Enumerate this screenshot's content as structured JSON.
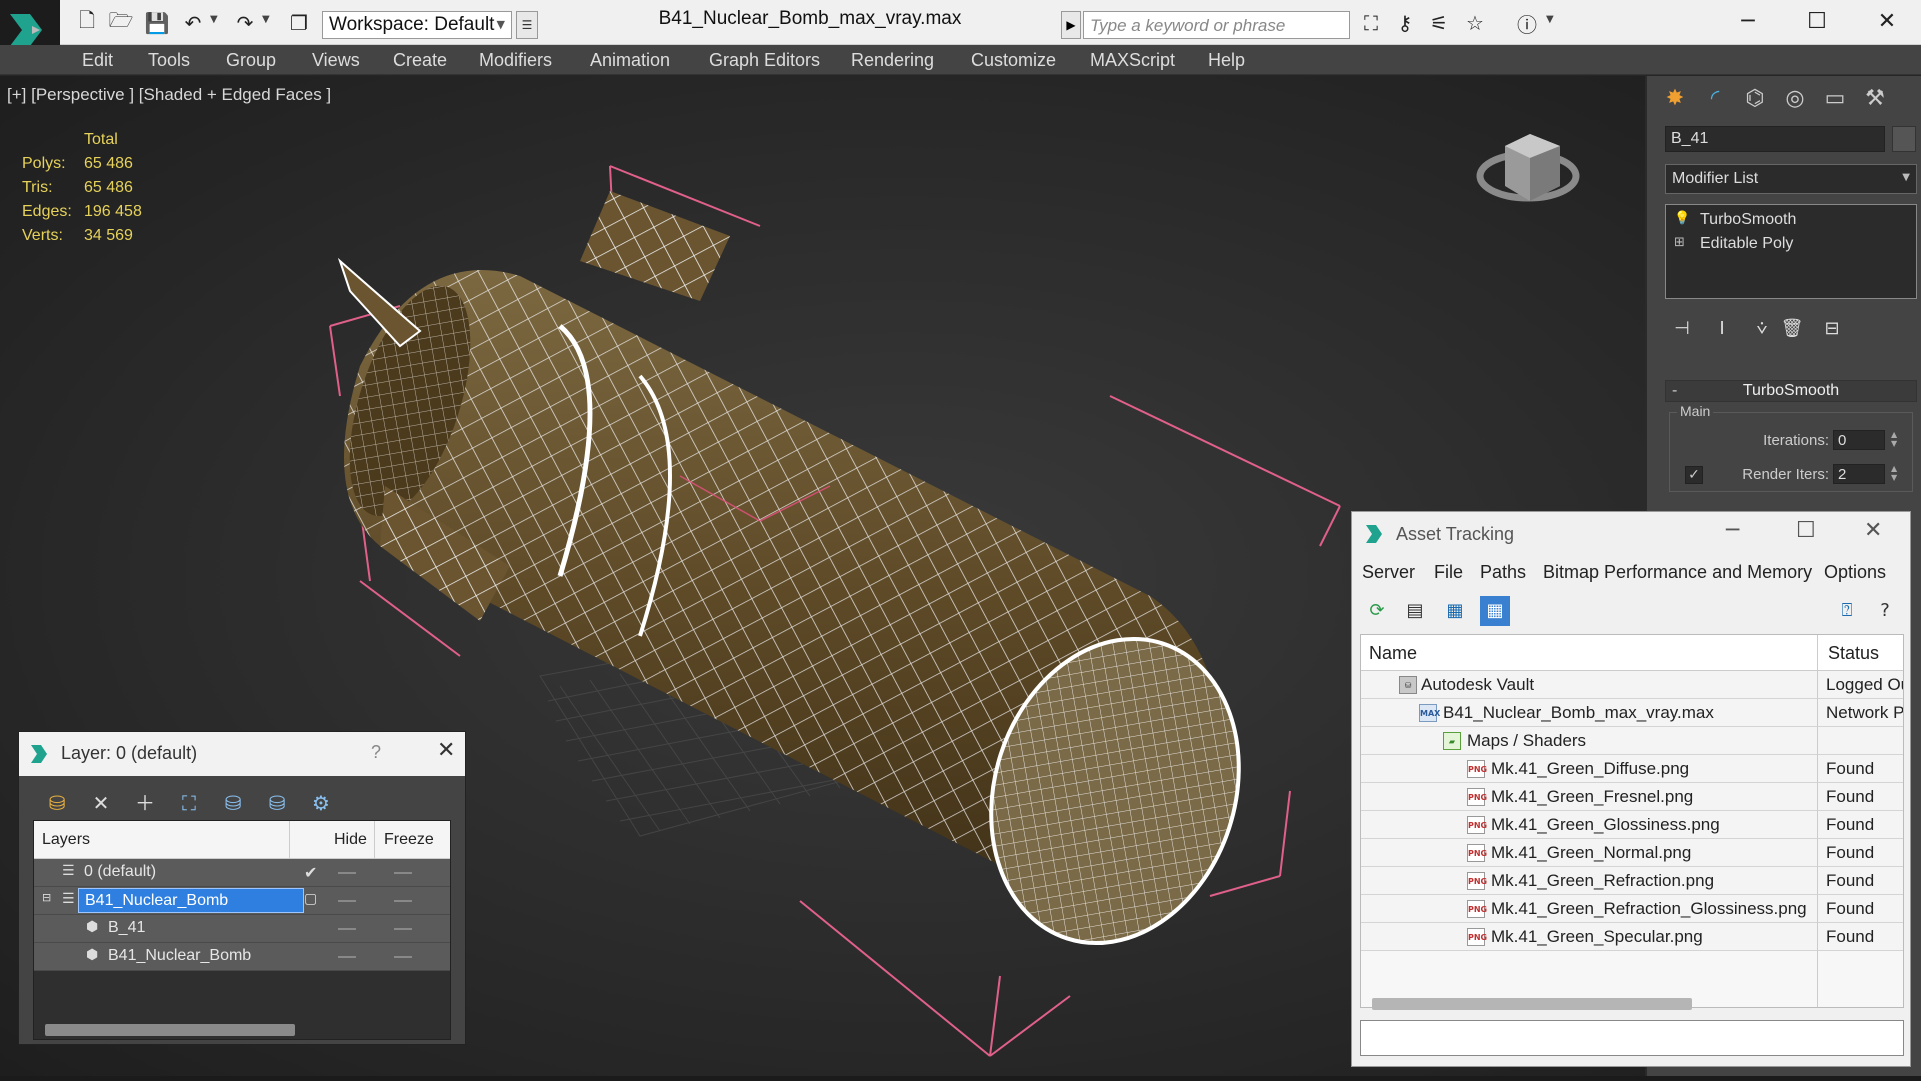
{
  "window": {
    "title": "B41_Nuclear_Bomb_max_vray.max",
    "workspace": "Workspace: Default",
    "search_placeholder": "Type a keyword or phrase"
  },
  "menu": [
    "Edit",
    "Tools",
    "Group",
    "Views",
    "Create",
    "Modifiers",
    "Animation",
    "Graph Editors",
    "Rendering",
    "Customize",
    "MAXScript",
    "Help"
  ],
  "viewport": {
    "label": "[+] [Perspective ] [Shaded + Edged Faces ]",
    "stats": {
      "header": "Total",
      "rows": [
        {
          "label": "Polys:",
          "value": "65 486"
        },
        {
          "label": "Tris:",
          "value": "65 486"
        },
        {
          "label": "Edges:",
          "value": "196 458"
        },
        {
          "label": "Verts:",
          "value": "34 569"
        }
      ]
    }
  },
  "command_panel": {
    "object_name": "B_41",
    "modifier_list": "Modifier List",
    "stack": [
      {
        "label": "TurboSmooth",
        "icon": "lightbulb-icon"
      },
      {
        "label": "Editable Poly",
        "icon": "plus-icon"
      }
    ],
    "rollout": {
      "title": "TurboSmooth",
      "group": "Main",
      "iterations_label": "Iterations:",
      "iterations_value": "0",
      "render_iters_label": "Render Iters:",
      "render_iters_value": "2",
      "render_iters_checked": true
    }
  },
  "layer_dialog": {
    "title": "Layer: 0 (default)",
    "help": "?",
    "columns": {
      "layers": "Layers",
      "hide": "Hide",
      "freeze": "Freeze"
    },
    "rows": [
      {
        "name": "0 (default)",
        "indent": 0,
        "icon": "layer-icon",
        "current": true,
        "selected": false
      },
      {
        "name": "B41_Nuclear_Bomb",
        "indent": 0,
        "icon": "layer-icon",
        "current": false,
        "selected": true
      },
      {
        "name": "B_41",
        "indent": 1,
        "icon": "object-icon",
        "current": false,
        "selected": false
      },
      {
        "name": "B41_Nuclear_Bomb",
        "indent": 1,
        "icon": "object-icon",
        "current": false,
        "selected": false
      }
    ]
  },
  "asset_tracking": {
    "title": "Asset Tracking",
    "menu": [
      "Server",
      "File",
      "Paths",
      "Bitmap Performance and Memory",
      "Options"
    ],
    "columns": {
      "name": "Name",
      "status": "Status"
    },
    "rows": [
      {
        "name": "Autodesk Vault",
        "status": "Logged Out",
        "level": 0,
        "icon": "vault"
      },
      {
        "name": "B41_Nuclear_Bomb_max_vray.max",
        "status": "Network Path",
        "level": 1,
        "icon": "max"
      },
      {
        "name": "Maps / Shaders",
        "status": "",
        "level": 2,
        "icon": "folder"
      },
      {
        "name": "Mk.41_Green_Diffuse.png",
        "status": "Found",
        "level": 3,
        "icon": "png"
      },
      {
        "name": "Mk.41_Green_Fresnel.png",
        "status": "Found",
        "level": 3,
        "icon": "png"
      },
      {
        "name": "Mk.41_Green_Glossiness.png",
        "status": "Found",
        "level": 3,
        "icon": "png"
      },
      {
        "name": "Mk.41_Green_Normal.png",
        "status": "Found",
        "level": 3,
        "icon": "png"
      },
      {
        "name": "Mk.41_Green_Refraction.png",
        "status": "Found",
        "level": 3,
        "icon": "png"
      },
      {
        "name": "Mk.41_Green_Refraction_Glossiness.png",
        "status": "Found",
        "level": 3,
        "icon": "png"
      },
      {
        "name": "Mk.41_Green_Specular.png",
        "status": "Found",
        "level": 3,
        "icon": "png"
      }
    ]
  },
  "colors": {
    "stats_text": "#e6d25a",
    "selection": "#2f7fe0",
    "bomb_body": "#6e5a35",
    "bounding_box": "#e0608a"
  }
}
